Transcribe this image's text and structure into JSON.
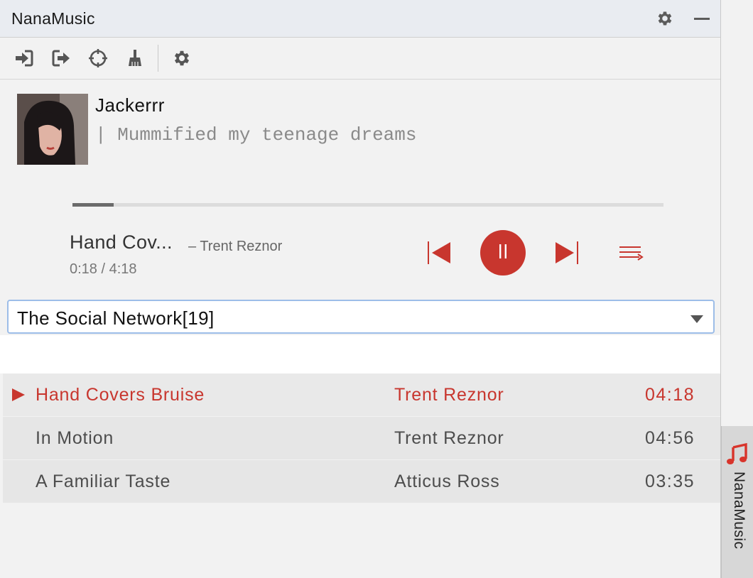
{
  "window": {
    "title": "NanaMusic"
  },
  "titlebar_icons": [
    "gear-icon",
    "minimize-icon"
  ],
  "toolbar": {
    "icons": [
      "login-icon",
      "logout-icon",
      "locate-icon",
      "broom-icon",
      "gear-icon"
    ]
  },
  "user": {
    "name": "Jackerrr",
    "signature": "| Mummified my teenage dreams"
  },
  "player": {
    "progress": 0.07,
    "song_title": "Hand Cov...",
    "artist": "– Trent Reznor",
    "time": "0:18 / 4:18",
    "accent_color": "#c8362e",
    "controls": [
      "previous-icon",
      "pause-icon",
      "next-icon",
      "playlist-icon"
    ]
  },
  "playlist": {
    "selected": "The Social Network[19]"
  },
  "tracks": [
    {
      "name": "Hand Covers Bruise",
      "artist": "Trent Reznor",
      "duration": "04:18",
      "playing": true
    },
    {
      "name": "In Motion",
      "artist": "Trent Reznor",
      "duration": "04:56",
      "playing": false
    },
    {
      "name": "A Familiar Taste",
      "artist": "Atticus Ross",
      "duration": "03:35",
      "playing": false
    }
  ],
  "side_tab": {
    "label": "NanaMusic",
    "icon": "music-note-icon"
  }
}
